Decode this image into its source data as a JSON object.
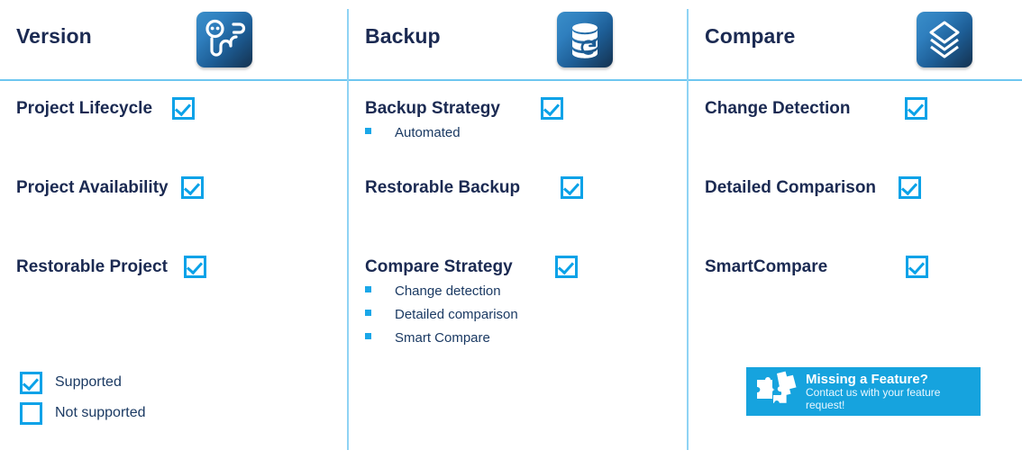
{
  "columns": [
    {
      "title": "Version",
      "icon": "person-workflow-icon",
      "features": [
        {
          "label": "Project Lifecycle",
          "state": "supported",
          "subitems": []
        },
        {
          "label": "Project Availability",
          "state": "supported",
          "subitems": []
        },
        {
          "label": "Restorable Project",
          "state": "supported",
          "subitems": []
        }
      ]
    },
    {
      "title": "Backup",
      "icon": "database-restore-icon",
      "features": [
        {
          "label": "Backup Strategy",
          "state": "supported",
          "subitems": [
            "Automated"
          ]
        },
        {
          "label": "Restorable Backup",
          "state": "supported",
          "subitems": []
        },
        {
          "label": "Compare Strategy",
          "state": "supported",
          "subitems": [
            "Change detection",
            "Detailed comparison",
            "Smart Compare"
          ]
        }
      ]
    },
    {
      "title": "Compare",
      "icon": "stacked-layers-icon",
      "features": [
        {
          "label": "Change Detection",
          "state": "supported",
          "subitems": []
        },
        {
          "label": "Detailed Comparison",
          "state": "supported",
          "subitems": []
        },
        {
          "label": "SmartCompare",
          "state": "supported",
          "subitems": []
        }
      ]
    }
  ],
  "legend": {
    "supported_label": "Supported",
    "not_supported_label": "Not supported"
  },
  "banner": {
    "title": "Missing a Feature?",
    "subtitle": "Contact us with your feature request!",
    "icon": "puzzle-pieces-icon",
    "background": "#16a3de"
  },
  "colors": {
    "heading": "#1b2a52",
    "accent": "#0aa2e8",
    "divider": "#8fd3f4",
    "bullet": "#1aa7e8",
    "body_text": "#1b3a63"
  }
}
